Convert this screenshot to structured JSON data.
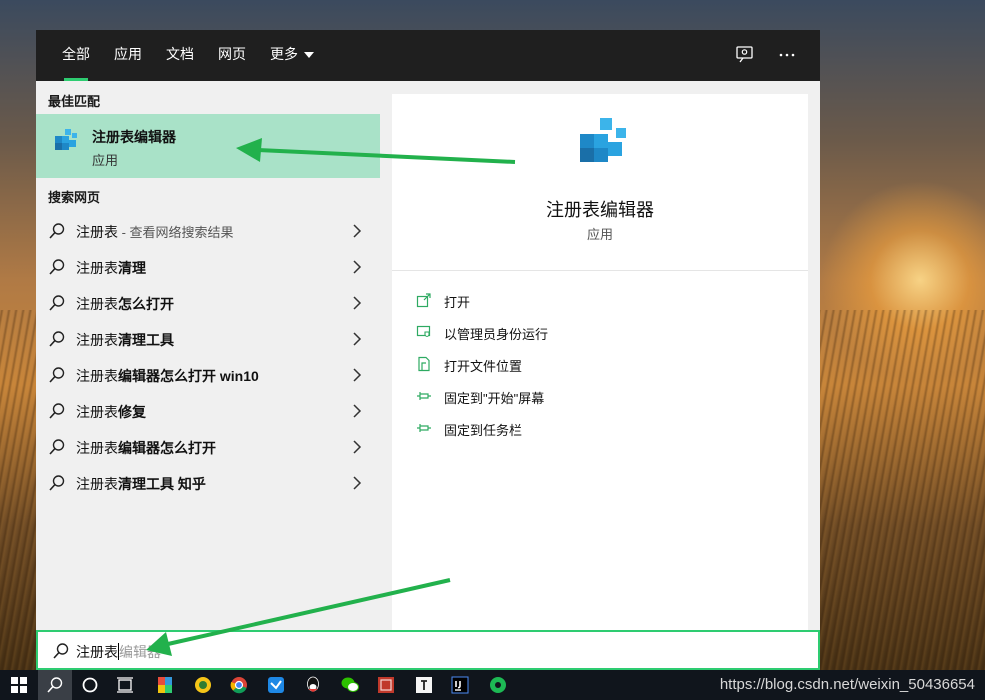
{
  "tabs": [
    {
      "label": "全部"
    },
    {
      "label": "应用"
    },
    {
      "label": "文档"
    },
    {
      "label": "网页"
    },
    {
      "label": "更多"
    }
  ],
  "top_icons": [
    "feedback-icon",
    "more-options-icon"
  ],
  "best_match": {
    "section_title": "最佳匹配",
    "title": "注册表编辑器",
    "subtitle": "应用",
    "icon": "registry-editor-icon"
  },
  "web_search": {
    "section_title": "搜索网页",
    "items": [
      {
        "prefix": "注册表",
        "bold": "",
        "hint": " - 查看网络搜索结果"
      },
      {
        "prefix": "注册表",
        "bold": "清理",
        "hint": ""
      },
      {
        "prefix": "注册表",
        "bold": "怎么打开",
        "hint": ""
      },
      {
        "prefix": "注册表",
        "bold": "清理工具",
        "hint": ""
      },
      {
        "prefix": "注册表",
        "bold": "编辑器怎么打开 win10",
        "hint": ""
      },
      {
        "prefix": "注册表",
        "bold": "修复",
        "hint": ""
      },
      {
        "prefix": "注册表",
        "bold": "编辑器怎么打开",
        "hint": ""
      },
      {
        "prefix": "注册表",
        "bold": "清理工具 知乎",
        "hint": ""
      }
    ]
  },
  "detail": {
    "title": "注册表编辑器",
    "type": "应用",
    "actions": [
      {
        "label": "打开",
        "icon": "open-icon"
      },
      {
        "label": "以管理员身份运行",
        "icon": "run-as-admin-icon"
      },
      {
        "label": "打开文件位置",
        "icon": "file-location-icon"
      },
      {
        "label": "固定到\"开始\"屏幕",
        "icon": "pin-icon"
      },
      {
        "label": "固定到任务栏",
        "icon": "pin-icon"
      }
    ]
  },
  "search": {
    "typed": "注册表",
    "autocomplete": "编辑器"
  },
  "taskbar": {
    "icons": [
      "windows-start-icon",
      "search-icon",
      "cortana-icon",
      "task-view-icon",
      "app-icon",
      "app-icon",
      "chrome-icon",
      "app-icon",
      "qq-icon",
      "wechat-icon",
      "app-icon",
      "app-icon",
      "intellij-icon",
      "app-icon"
    ],
    "watermark": "https://blog.csdn.net/weixin_50436654"
  },
  "colors": {
    "accent": "#2ecc71",
    "selected_bg": "#a9e2c8",
    "top_bar": "#1f1f1f",
    "annotation_arrow": "#22b14c"
  }
}
